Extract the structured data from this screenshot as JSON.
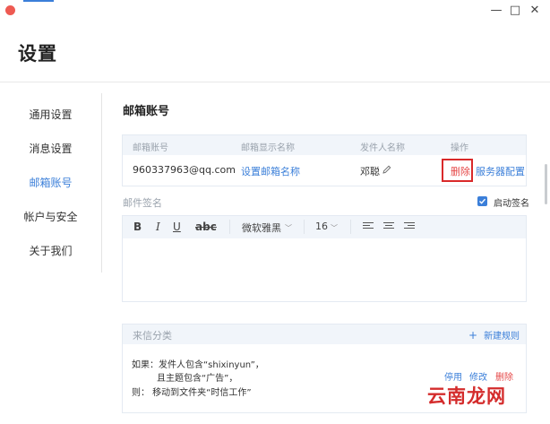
{
  "window": {
    "title": "设置",
    "controls": {
      "minimize": "—",
      "maximize": "□",
      "close": "✕"
    }
  },
  "sidebar": {
    "items": [
      {
        "label": "通用设置",
        "active": false
      },
      {
        "label": "消息设置",
        "active": false
      },
      {
        "label": "邮箱账号",
        "active": true
      },
      {
        "label": "帐户与安全",
        "active": false
      },
      {
        "label": "关于我们",
        "active": false
      }
    ]
  },
  "mail_accounts": {
    "section_title": "邮箱账号",
    "columns": [
      "邮箱账号",
      "邮箱显示名称",
      "发件人名称",
      "操作"
    ],
    "row": {
      "email": "960337963@qq.com",
      "display_name_link": "设置邮箱名称",
      "sender_name": "邓聪",
      "delete": "删除",
      "server_config": "服务器配置"
    }
  },
  "signature": {
    "label": "邮件签名",
    "enable_label": "启动签名",
    "enabled": true,
    "toolbar": {
      "bold": "B",
      "italic": "I",
      "underline": "U",
      "strike": "abc",
      "font": "微软雅黑",
      "size": "16",
      "dropdown_arrow": "﹀"
    }
  },
  "rules": {
    "title": "来信分类",
    "new_rule_plus": "+",
    "new_rule": "新建规则",
    "line1": "如果：发件人包含“shixinyun”，",
    "line2": "且主题包含“广告”，",
    "line3": "则：   移动到文件夹“时信工作”",
    "disable": "停用",
    "edit": "修改",
    "delete": "删除"
  },
  "watermark": "云南龙网",
  "colors": {
    "accent": "#3b7fd9",
    "danger": "#e54848",
    "highlight_box": "#d9292a",
    "header_bg": "#f1f5fa"
  }
}
